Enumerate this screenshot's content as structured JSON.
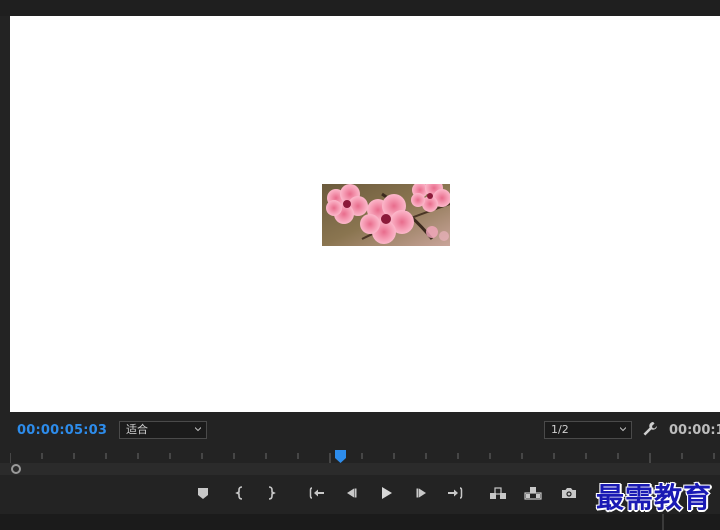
{
  "monitor": {
    "timecode_current": "00:00:05:03",
    "timecode_duration": "00:00:1",
    "fit_select": {
      "value": "适合"
    },
    "resolution_select": {
      "value": "1/2"
    }
  },
  "playhead_fraction": 0.465,
  "transport": {
    "buttons": [
      {
        "name": "add-marker-button",
        "icon": "marker-icon"
      },
      {
        "name": "mark-in-button",
        "icon": "mark-in-icon"
      },
      {
        "name": "mark-out-button",
        "icon": "mark-out-icon"
      },
      {
        "name": "go-to-in-button",
        "icon": "go-to-in-icon"
      },
      {
        "name": "step-back-button",
        "icon": "step-back-icon"
      },
      {
        "name": "play-button",
        "icon": "play-icon"
      },
      {
        "name": "step-forward-button",
        "icon": "step-forward-icon"
      },
      {
        "name": "go-to-out-button",
        "icon": "go-to-out-icon"
      },
      {
        "name": "insert-button",
        "icon": "insert-icon"
      },
      {
        "name": "overwrite-button",
        "icon": "overwrite-icon"
      },
      {
        "name": "export-frame-button",
        "icon": "camera-icon"
      }
    ]
  },
  "watermark": {
    "text": "最需教育"
  },
  "colors": {
    "accent_blue": "#2d8ceb",
    "panel_bg": "#232323",
    "monitor_bg": "#ffffff",
    "icon_gray": "#bdbdbd"
  }
}
